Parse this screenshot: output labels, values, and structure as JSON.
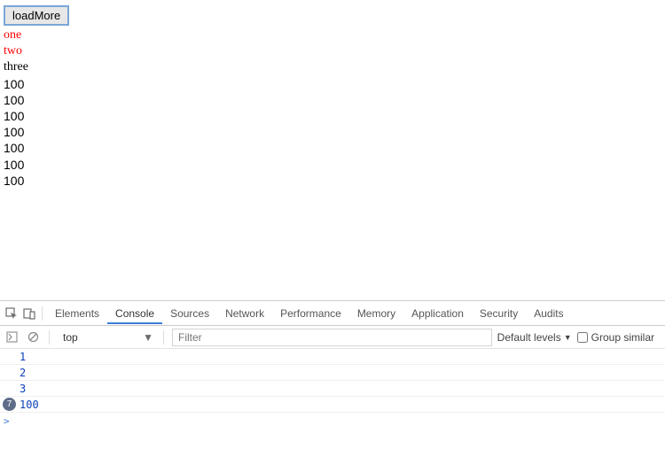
{
  "page": {
    "button_label": "loadMore",
    "items": [
      {
        "text": "one",
        "cls": "item item-red"
      },
      {
        "text": "two",
        "cls": "item item-red"
      },
      {
        "text": "three",
        "cls": "item item-black"
      },
      {
        "text": "100",
        "cls": "item-num"
      },
      {
        "text": "100",
        "cls": "item-num"
      },
      {
        "text": "100",
        "cls": "item-num"
      },
      {
        "text": "100",
        "cls": "item-num"
      },
      {
        "text": "100",
        "cls": "item-num"
      },
      {
        "text": "100",
        "cls": "item-num"
      },
      {
        "text": "100",
        "cls": "item-num"
      }
    ]
  },
  "devtools": {
    "tabs": [
      "Elements",
      "Console",
      "Sources",
      "Network",
      "Performance",
      "Memory",
      "Application",
      "Security",
      "Audits"
    ],
    "active_tab": "Console",
    "context": "top",
    "filter_placeholder": "Filter",
    "levels_label": "Default levels",
    "group_similar_label": "Group similar",
    "console_rows": [
      "1",
      "2",
      "3"
    ],
    "badge_count": "7",
    "badge_value": "100",
    "prompt": ">"
  }
}
